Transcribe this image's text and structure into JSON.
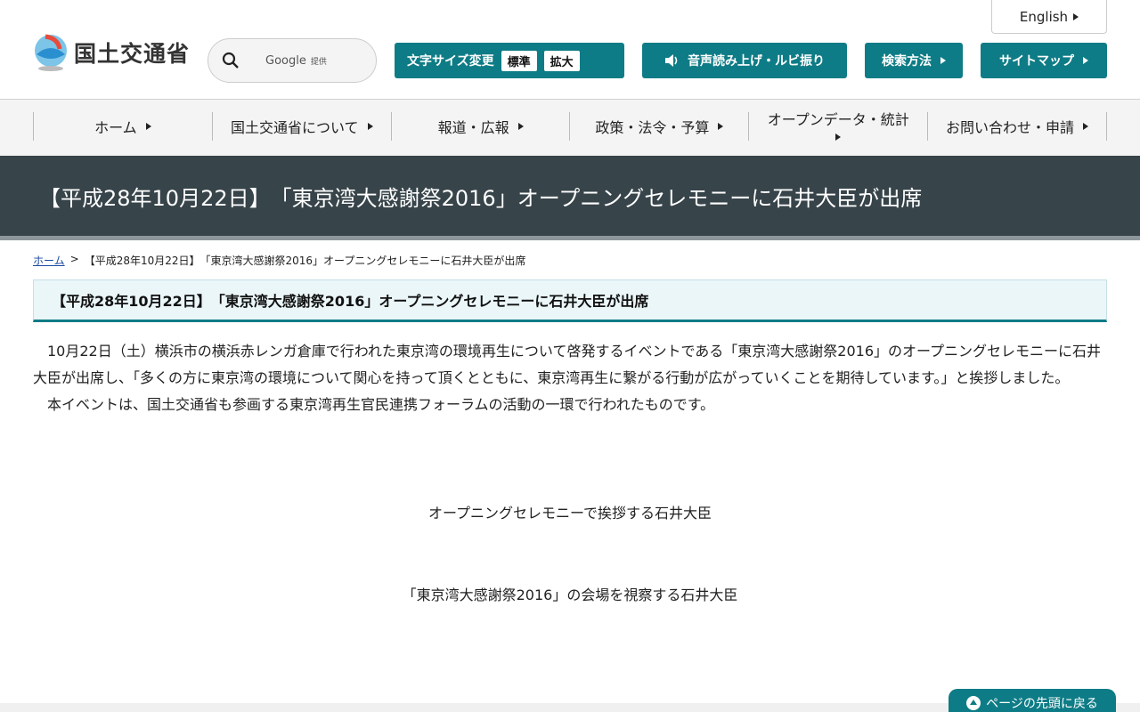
{
  "header": {
    "logo_text": "国土交通省",
    "search": {
      "label": "Google",
      "sub": "提供"
    },
    "english": "English",
    "font_size": {
      "label": "文字サイズ変更",
      "standard": "標準",
      "large": "拡大"
    },
    "voice": "音声読み上げ・ルビ振り",
    "search_method": "検索方法",
    "sitemap": "サイトマップ"
  },
  "nav": {
    "items": [
      {
        "label": "ホーム"
      },
      {
        "label": "国土交通省について"
      },
      {
        "label": "報道・広報"
      },
      {
        "label": "政策・法令・予算"
      },
      {
        "label": "オープンデータ・統計"
      },
      {
        "label": "お問い合わせ・申請"
      }
    ]
  },
  "page": {
    "title": "【平成28年10月22日】　「東京湾大感謝祭2016」オープニングセレモニーに石井大臣が出席",
    "breadcrumb": {
      "home": "ホーム",
      "sep": ">",
      "current": "【平成28年10月22日】　「東京湾大感謝祭2016」オープニングセレモニーに石井大臣が出席"
    },
    "heading": "【平成28年10月22日】　「東京湾大感謝祭2016」オープニングセレモニーに石井大臣が出席",
    "paragraph1": "10月22日（土）横浜市の横浜赤レンガ倉庫で行われた東京湾の環境再生について啓発するイベントである「東京湾大感謝祭2016」のオープニングセレモニーに石井大臣が出席し、「多くの方に東京湾の環境について関心を持って頂くとともに、東京湾再生に繋がる行動が広がっていくことを期待しています。」と挨拶しました。",
    "paragraph2": "本イベントは、国土交通省も参画する東京湾再生官民連携フォーラムの活動の一環で行われたものです。",
    "caption1": "オープニングセレモニーで挨拶する石井大臣",
    "caption2": "「東京湾大感謝祭2016」の会場を視察する石井大臣"
  },
  "pagetop": "ページの先頭に戻る",
  "colors": {
    "accent": "#0e7c86",
    "title_band": "#37444a",
    "link": "#1a4aa0"
  }
}
